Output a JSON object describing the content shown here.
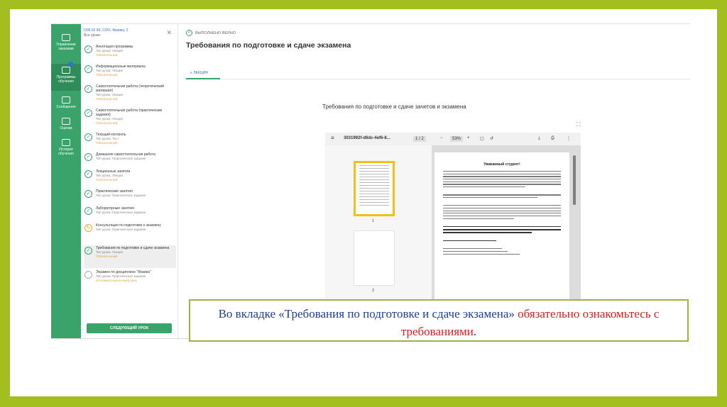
{
  "rail": [
    {
      "label": "Управление заказами",
      "icon": "documents-icon"
    },
    {
      "label": "Программы обучения",
      "icon": "programs-icon"
    },
    {
      "label": "Сообщения",
      "icon": "mail-icon"
    },
    {
      "label": "Оценки",
      "icon": "grades-icon"
    },
    {
      "label": "История обучения",
      "icon": "history-icon"
    }
  ],
  "course": {
    "code": "О09.02.96, СОО, Физика, 2",
    "all_lessons": "Все уроки",
    "lessons": [
      {
        "title": "Аннотация программы",
        "type": "Тип урока: Лекция",
        "status": "Обязательный"
      },
      {
        "title": "Информационные материалы",
        "type": "Тип урока: Лекция",
        "status": "Обязательный"
      },
      {
        "title": "Самостоятельная работа (теоретический материал)",
        "type": "Тип урока: Лекция",
        "status": "Обязательный"
      },
      {
        "title": "Самостоятельная работа (практические задания)",
        "type": "Тип урока: Лекция",
        "status": "Обязательный"
      },
      {
        "title": "Текущий контроль",
        "type": "Тип урока: Тест",
        "status": "Обязательный"
      },
      {
        "title": "Домашняя самостоятельная работа",
        "type": "Тип урока: Практическое задание",
        "status": ""
      },
      {
        "title": "Лекционные занятия",
        "type": "Тип урока: Лекция",
        "status": "Обязательный"
      },
      {
        "title": "Практические занятия",
        "type": "Тип урока: Практическое задание",
        "status": ""
      },
      {
        "title": "Лабораторные занятия",
        "type": "Тип урока: Практическое задание",
        "status": ""
      },
      {
        "title": "Консультация по подготовке к экзамену",
        "type": "Тип урока: Практическое задание",
        "status": ""
      },
      {
        "title": "Требования по подготовке и сдаче экзамена",
        "type": "Тип урока: Лекция",
        "status": "Обязательный"
      },
      {
        "title": "Экзамен по дисциплине \"Физика\"",
        "type": "Тип урока: Практическое задание",
        "status": "Итоговый (оценочный) урок"
      }
    ],
    "next_button": "СЛЕДУЮЩИЙ УРОК"
  },
  "main": {
    "status": "ВЫПОЛНЕНО ВЕРНО",
    "title": "Требования по подготовке и сдаче экзамена",
    "tab": "ЛЕКЦИЯ",
    "doc_title": "Требования по подготовке и сдаче зачетов и экзамена"
  },
  "viewer": {
    "file_name": "3031992f-d6dc-4ef6-8...",
    "page": "1 / 2",
    "zoom": "53%",
    "thumb_labels": [
      "1",
      "2"
    ],
    "page_heading": "Уважаемый студент!"
  },
  "callout": {
    "part1": "Во вкладке «Требования по подготовке и сдаче экзамена» ",
    "part2": "обязательно ознакомьтесь с требованиями",
    "part3": "."
  },
  "colors": {
    "accent": "#3aa36a",
    "frame": "#a3bf1f",
    "callout_text": "#1f3b95",
    "callout_highlight": "#d62020"
  }
}
